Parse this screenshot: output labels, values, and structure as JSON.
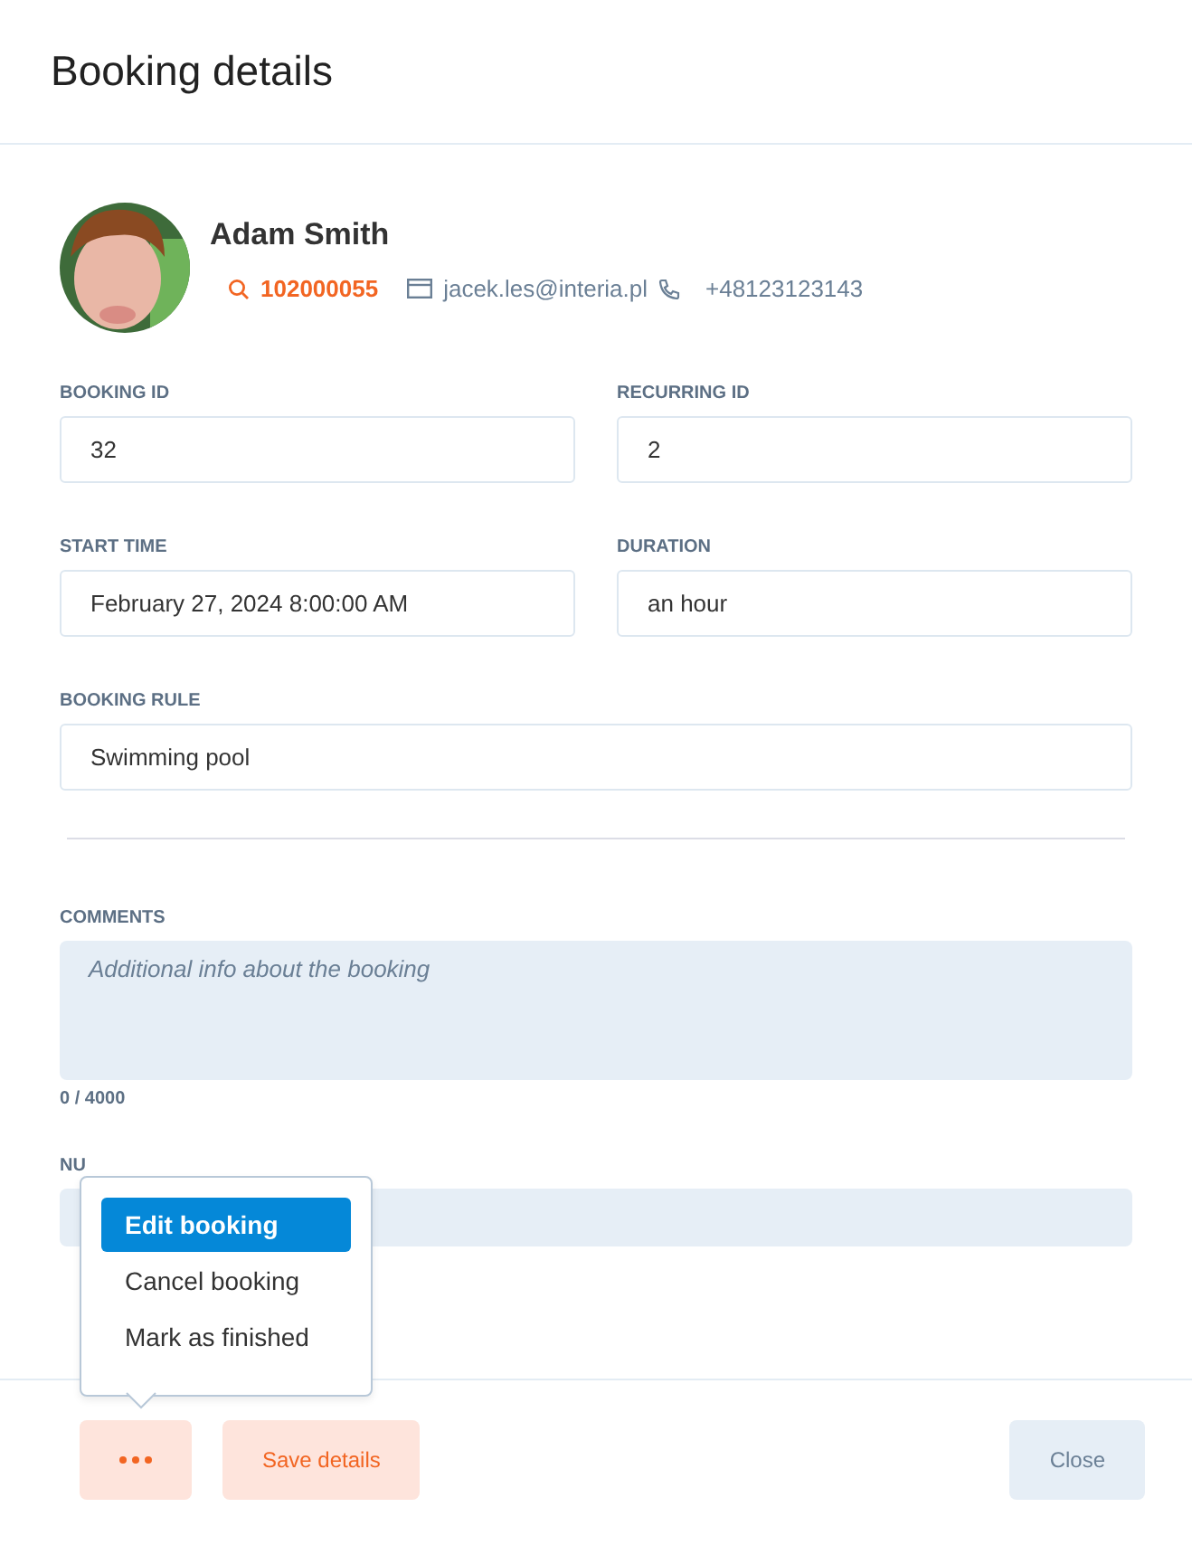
{
  "title": "Booking details",
  "client": {
    "name": "Adam Smith",
    "id": "102000055",
    "email": "jacek.les@interia.pl",
    "phone": "+48123123143"
  },
  "field_rows": [
    [
      {
        "label": "BOOKING ID",
        "value": "32"
      },
      {
        "label": "RECURRING ID",
        "value": "2"
      }
    ],
    [
      {
        "label": "START TIME",
        "value": "February 27, 2024 8:00:00 AM"
      },
      {
        "label": "DURATION",
        "value": "an hour"
      }
    ],
    [
      {
        "label": "BOOKING RULE",
        "value": "Swimming pool"
      }
    ]
  ],
  "comments": {
    "label": "COMMENTS",
    "placeholder": "Additional info about the booking",
    "counter": "0 / 4000"
  },
  "next_field": {
    "label": "NU"
  },
  "menu": {
    "items": [
      {
        "label": "Edit booking",
        "selected": true
      },
      {
        "label": "Cancel booking",
        "selected": false
      },
      {
        "label": "Mark as finished",
        "selected": false
      }
    ]
  },
  "buttons": {
    "save": "Save details",
    "close": "Close"
  }
}
